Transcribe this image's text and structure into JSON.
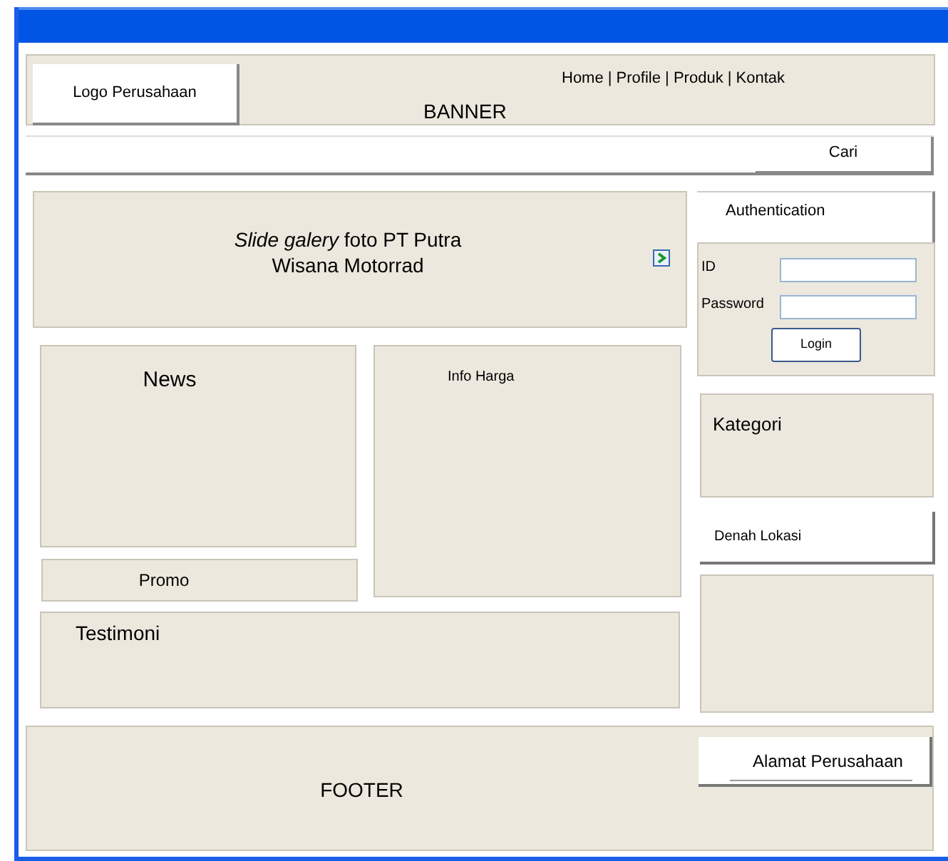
{
  "header": {
    "logo": "Logo Perusahaan",
    "nav": "Home | Profile | Produk | Kontak",
    "banner": "BANNER"
  },
  "search": {
    "button": "Cari"
  },
  "slide": {
    "text": "*Slide galery* foto PT Putra",
    "text_line2": "Wisana Motorrad"
  },
  "auth": {
    "title": "Authentication",
    "fields": [
      {
        "label": "ID"
      },
      {
        "label": "Password"
      }
    ],
    "button": "Login"
  },
  "news": {
    "title": "News"
  },
  "info_harga": {
    "title": "Info Harga"
  },
  "promo": {
    "title": "Promo"
  },
  "testimoni": {
    "title": "Testimoni"
  },
  "kategori": {
    "title": "Kategori"
  },
  "denah_lokasi": {
    "title": "Denah Lokasi"
  },
  "footer": {
    "title": "FOOTER",
    "address_title": "Alamat Perusahaan"
  }
}
